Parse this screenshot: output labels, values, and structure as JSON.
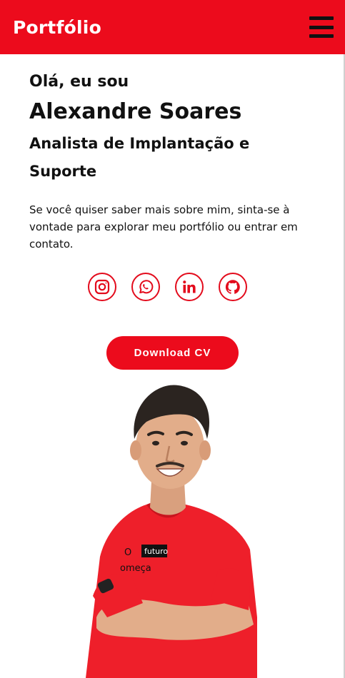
{
  "header": {
    "brand": "Portfólio",
    "menu_icon": "hamburger-menu-icon",
    "color": "#ec0b1c"
  },
  "hero": {
    "greeting": "Olá, eu sou",
    "name": "Alexandre Soares",
    "role": "Analista de Implantação e Suporte",
    "intro": "Se você quiser saber mais sobre mim, sinta-se à vontade para explorar meu portfólio ou entrar em contato."
  },
  "socials": [
    {
      "icon": "instagram-icon"
    },
    {
      "icon": "whatsapp-icon"
    },
    {
      "icon": "linkedin-icon"
    },
    {
      "icon": "github-icon"
    }
  ],
  "cta": {
    "label": "Download CV"
  },
  "portrait": {
    "shirt_text": "O futuro começa"
  }
}
